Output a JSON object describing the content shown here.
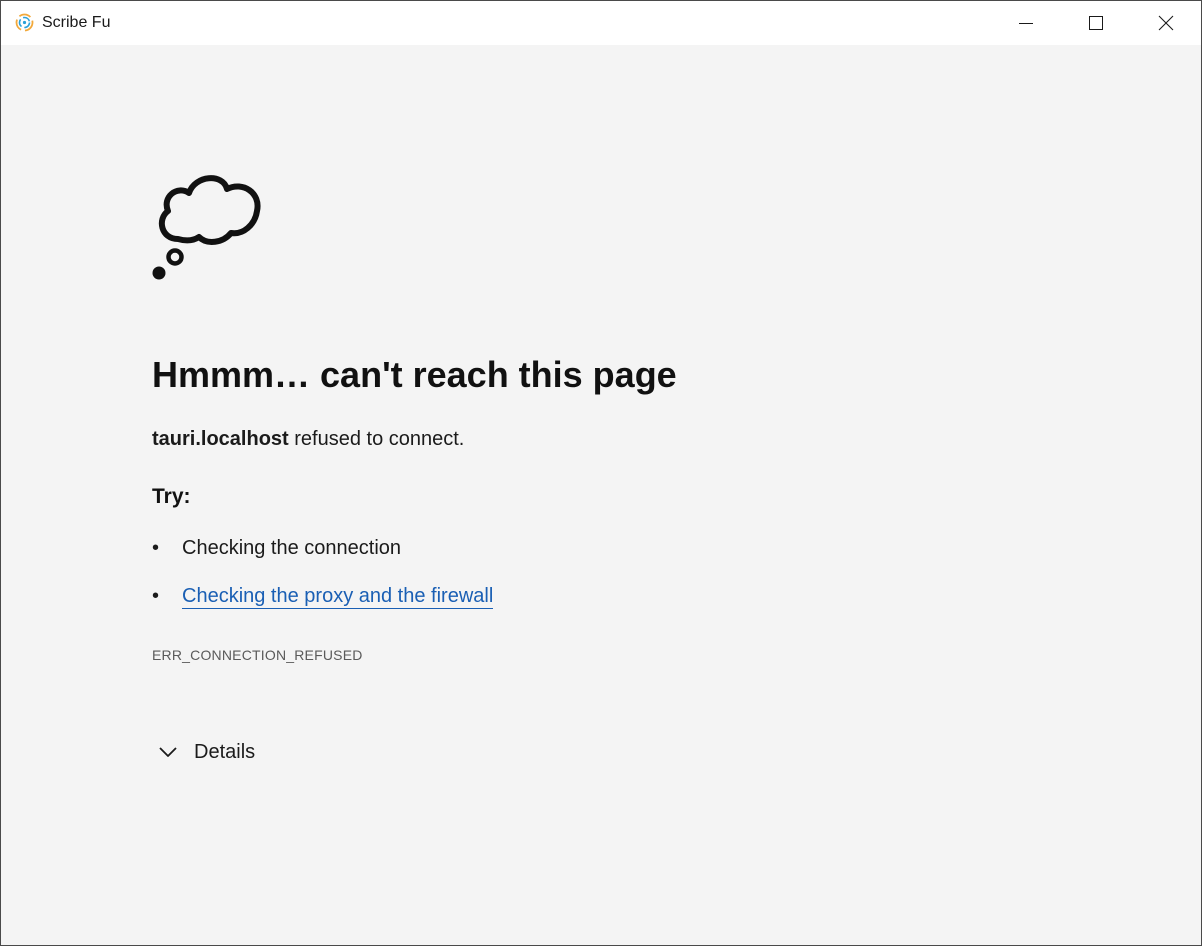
{
  "window": {
    "title": "Scribe Fu",
    "controls": {
      "minimize": "minimize-icon",
      "maximize": "maximize-icon",
      "close": "close-icon"
    }
  },
  "error_page": {
    "icon": "thought-cloud-icon",
    "heading": "Hmmm… can't reach this page",
    "host": "tauri.localhost",
    "message_suffix": " refused to connect.",
    "try_label": "Try:",
    "suggestions": [
      {
        "text": "Checking the connection",
        "is_link": false
      },
      {
        "text": "Checking the proxy and the firewall",
        "is_link": true
      }
    ],
    "error_code": "ERR_CONNECTION_REFUSED",
    "details_label": "Details"
  },
  "colors": {
    "page_background": "#f4f4f4",
    "titlebar_background": "#ffffff",
    "text": "#111111",
    "link": "#1a5fb4",
    "muted": "#5a5a5a"
  }
}
